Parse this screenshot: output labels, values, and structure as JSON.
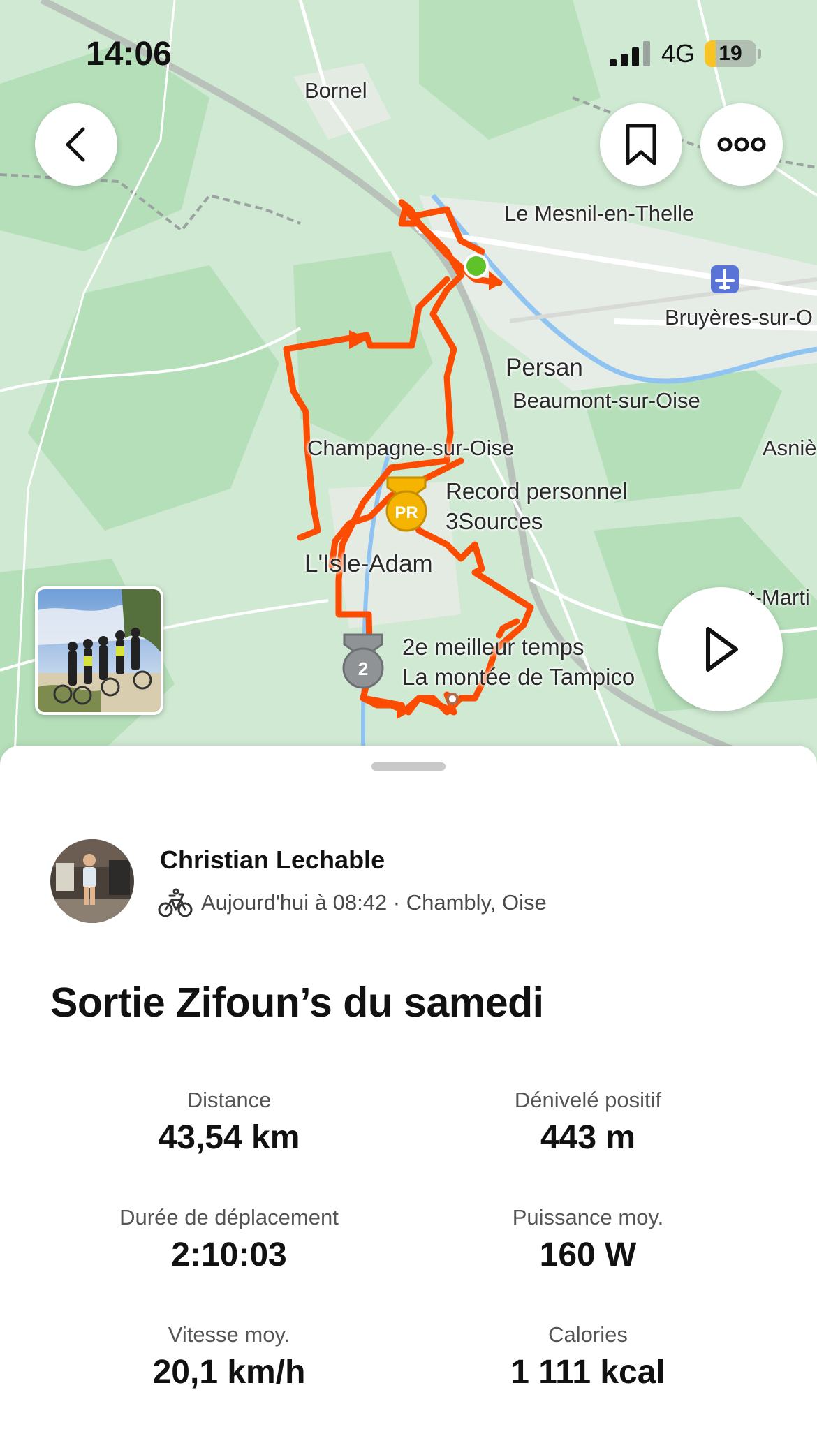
{
  "status_bar": {
    "time": "14:06",
    "network": "4G",
    "battery": "19"
  },
  "map": {
    "places": {
      "bornel": "Bornel",
      "mesnil": "Le Mesnil-en-Thelle",
      "bruyeres": "Bruyères-sur-O",
      "persan": "Persan",
      "beaumont": "Beaumont-sur-Oise",
      "asnieres": "Asniè",
      "champagne": "Champagne-sur-Oise",
      "isle_adam": "L'Isle-Adam",
      "st_martin": "t-Marti"
    },
    "achievements": {
      "pr": {
        "line1": "Record personnel",
        "line2": "3Sources",
        "badge": "PR"
      },
      "second": {
        "line1": "2e meilleur temps",
        "line2": "La montée de Tampico",
        "badge": "2"
      }
    },
    "route_color": "#fc4c02"
  },
  "activity": {
    "athlete": "Christian Lechable",
    "meta": "Aujourd'hui à 08:42 · Chambly, Oise",
    "sport_icon": "bike-icon",
    "title": "Sortie Zifoun’s du samedi",
    "stats": {
      "distance": {
        "label": "Distance",
        "value": "43,54 km"
      },
      "elevation": {
        "label": "Dénivelé positif",
        "value": "443 m"
      },
      "moving_time": {
        "label": "Durée de déplacement",
        "value": "2:10:03"
      },
      "power": {
        "label": "Puissance moy.",
        "value": "160 W"
      },
      "speed": {
        "label": "Vitesse moy.",
        "value": "20,1 km/h"
      },
      "calories": {
        "label": "Calories",
        "value": "1 111 kcal"
      }
    }
  }
}
